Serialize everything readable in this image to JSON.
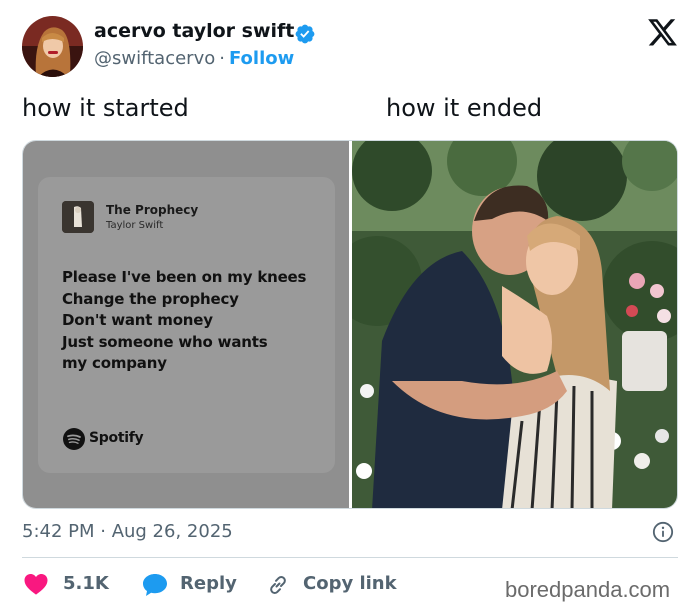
{
  "author": {
    "display_name": "acervo taylor swift",
    "handle": "@swiftacervo",
    "separator": "·",
    "follow_label": "Follow",
    "verified": true
  },
  "tweet": {
    "text_left": "how it started",
    "text_right": "how it ended"
  },
  "media": {
    "left_panel": {
      "song_title": "The Prophecy",
      "song_artist": "Taylor Swift",
      "lyrics": [
        "Please I've been on my knees",
        "Change the prophecy",
        "Don't want money",
        "Just someone who wants",
        "my company"
      ],
      "brand": "Spotify"
    },
    "right_panel": {
      "icon": "photo-couple"
    }
  },
  "meta": {
    "timestamp": "5:42 PM · Aug 26, 2025"
  },
  "actions": {
    "likes_count": "5.1K",
    "reply_label": "Reply",
    "copy_link_label": "Copy link"
  },
  "watermark": "boredpanda.com",
  "colors": {
    "accent": "#1d9bf0",
    "like": "#f91880",
    "reply": "#1d9bf0",
    "secondary_text": "#536471",
    "spotify_panel": "#8f8f8f"
  }
}
